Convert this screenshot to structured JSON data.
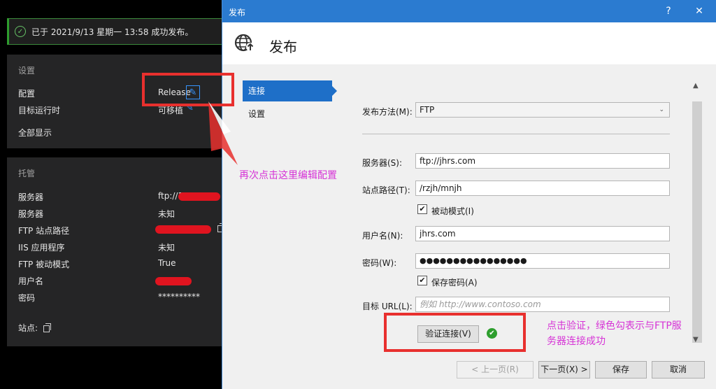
{
  "background_panel": {
    "success_message": "已于 2021/9/13 星期一 13:58 成功发布。",
    "settings": {
      "heading": "设置",
      "rows": [
        {
          "label": "配置",
          "value": "Release"
        },
        {
          "label": "目标运行时",
          "value": "可移植"
        }
      ],
      "show_all_link": "全部显示"
    },
    "hosting": {
      "heading": "托管",
      "rows": [
        {
          "label": "服务器",
          "value": "ftp://1"
        },
        {
          "label": "服务器",
          "value": "未知"
        },
        {
          "label": "FTP 站点路径",
          "value": ""
        },
        {
          "label": "IIS 应用程序",
          "value": "未知"
        },
        {
          "label": "FTP 被动模式",
          "value": "True"
        },
        {
          "label": "用户名",
          "value": ""
        },
        {
          "label": "密码",
          "value": "**********"
        }
      ],
      "site_label": "站点:"
    }
  },
  "annotations": {
    "edit_config_note": "再次点击这里编辑配置",
    "verify_note_line1": "点击验证，绿色勾表示与FTP服",
    "verify_note_line2": "务器连接成功"
  },
  "dialog": {
    "window_title": "发布",
    "help_button": "?",
    "close_button": "✕",
    "header_title": "发布",
    "nav": [
      {
        "label": "连接",
        "active": true
      },
      {
        "label": "设置",
        "active": false
      }
    ],
    "form": {
      "publish_method_label": "发布方法(M):",
      "publish_method_value": "FTP",
      "server_label": "服务器(S):",
      "server_value": "ftp://jhrs.com",
      "site_path_label": "站点路径(T):",
      "site_path_value": "/rzjh/mnjh",
      "passive_mode_label": "被动模式(I)",
      "passive_mode_checked": true,
      "username_label": "用户名(N):",
      "username_value": "jhrs.com",
      "password_label": "密码(W):",
      "password_value": "●●●●●●●●●●●●●●●●",
      "save_password_label": "保存密码(A)",
      "save_password_checked": true,
      "target_url_label": "目标 URL(L):",
      "target_url_placeholder": "例如 http://www.contoso.com",
      "verify_button": "验证连接(V)",
      "verify_status": "✔"
    },
    "footer": {
      "prev_button": "< 上一页(R)",
      "next_button": "下一页(X) >",
      "save_button": "保存",
      "cancel_button": "取消"
    }
  },
  "colors": {
    "accent_blue": "#2b7bd0",
    "annotation_red": "#e8302e",
    "annotation_text": "#d633d6",
    "success_green": "#2e9e2e"
  }
}
